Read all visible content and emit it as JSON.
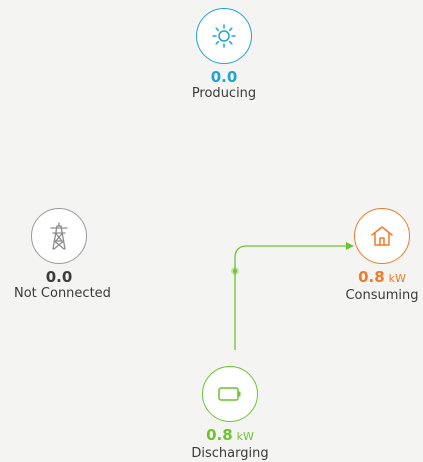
{
  "colors": {
    "solar": "#1fa5cf",
    "grid": "#9a9a9a",
    "home": "#f07b29",
    "battery": "#6cc42f",
    "flow_line": "#6cc42f"
  },
  "nodes": {
    "solar": {
      "value": "0.0",
      "unit": "",
      "label": "Producing",
      "icon": "sun-icon"
    },
    "grid": {
      "value": "0.0",
      "unit": "",
      "label": "Not Connected",
      "icon": "power-tower-icon"
    },
    "home": {
      "value": "0.8",
      "unit": "kW",
      "label": "Consuming",
      "icon": "house-icon"
    },
    "battery": {
      "value": "0.8",
      "unit": "kW",
      "label": "Discharging",
      "icon": "battery-icon"
    }
  }
}
